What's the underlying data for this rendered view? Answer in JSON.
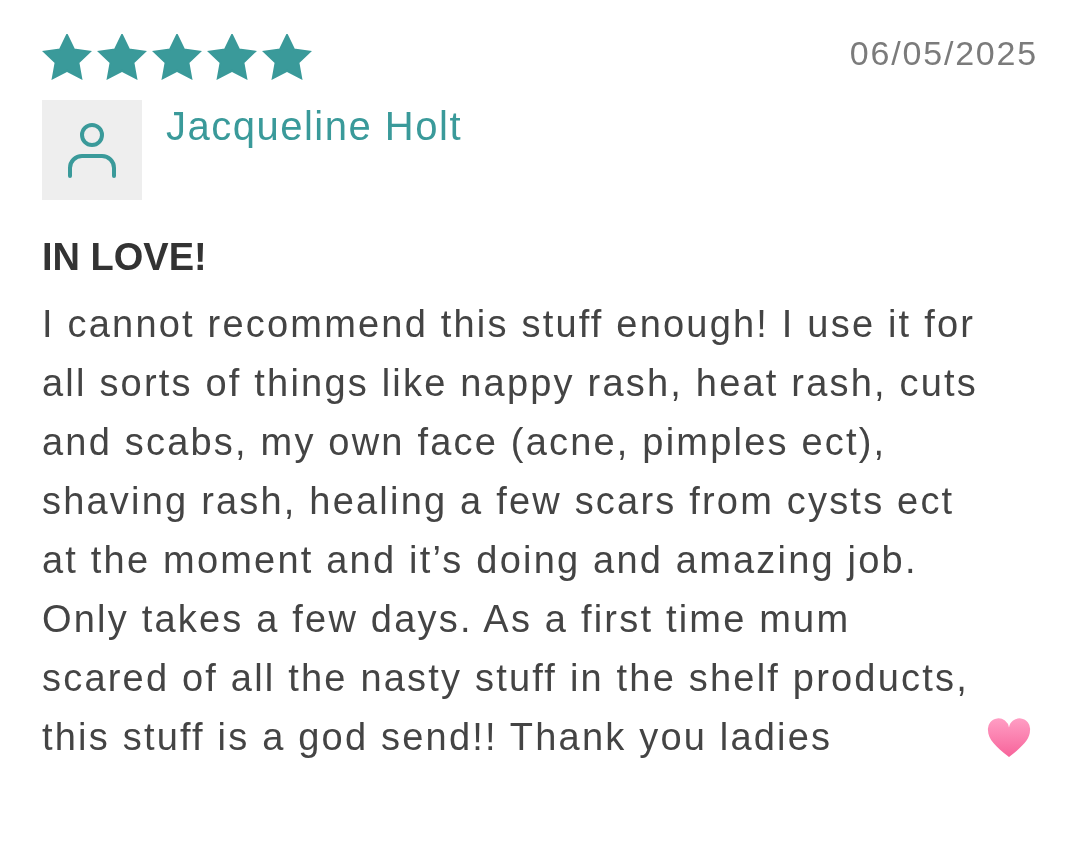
{
  "review": {
    "stars": 5,
    "date": "06/05/2025",
    "author": "Jacqueline Holt",
    "title": "IN LOVE!",
    "body": "I cannot recommend this stuff enough! I use it for all sorts of things like nappy rash, heat rash, cuts and scabs, my own face (acne, pimples ect), shaving rash, healing a few scars from cysts ect at the moment and it’s doing and amazing job. Only takes a few days. As a first time mum scared of all the nasty stuff in the shelf products, this stuff is a god send!! Thank you ladies"
  }
}
